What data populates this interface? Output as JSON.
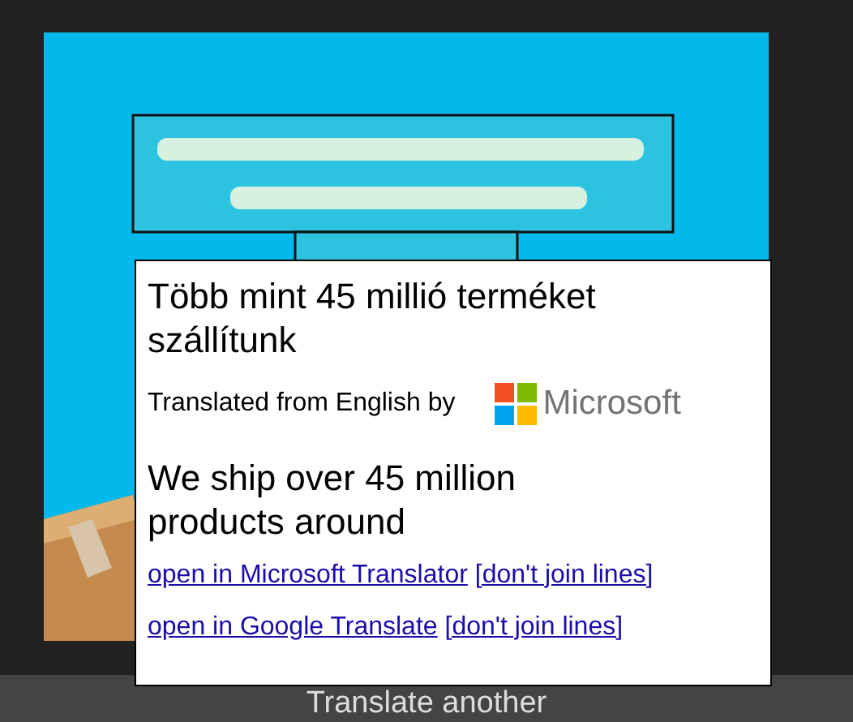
{
  "bottom_bar": {
    "label": "Translate another"
  },
  "popup": {
    "translation": "Több mint 45 millió terméket szállítunk",
    "attribution": "Translated from English by",
    "provider_logo": "Microsoft",
    "source_text": "We ship over 45 million products around",
    "links": [
      {
        "link": "open in Microsoft Translator",
        "option": "[don't join lines]"
      },
      {
        "link": "open in Google Translate",
        "option": "[don't join lines]"
      }
    ]
  }
}
